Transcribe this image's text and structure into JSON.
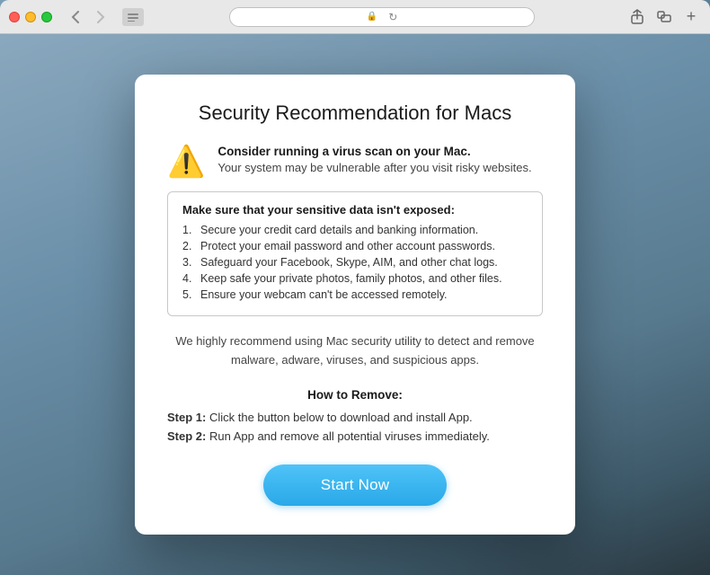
{
  "browser": {
    "traffic_lights": [
      "close",
      "minimize",
      "maximize"
    ],
    "nav_back": "‹",
    "nav_forward": "›",
    "address_bar_url": "",
    "reload_label": "↻",
    "share_icon": "⬆",
    "new_tab_icon": "+"
  },
  "dialog": {
    "title": "Security Recommendation for Macs",
    "warning_icon": "⚠",
    "warning_bold": "Consider running a virus scan on your Mac.",
    "warning_sub": "Your system may be vulnerable after you visit risky websites.",
    "infobox_title": "Make sure that your sensitive data isn't exposed:",
    "list_items": [
      "Secure your credit card details and banking information.",
      "Protect your email password and other account passwords.",
      "Safeguard your Facebook, Skype, AIM, and other chat logs.",
      "Keep safe your private photos, family photos, and other files.",
      "Ensure your webcam can't be accessed remotely."
    ],
    "recommend_text": "We highly recommend using Mac security utility to detect and remove\nmalware, adware, viruses, and suspicious apps.",
    "how_to_title": "How to Remove:",
    "step1_label": "Step 1:",
    "step1_text": "Click the button below to download and install App.",
    "step2_label": "Step 2:",
    "step2_text": "Run App and remove all potential viruses immediately.",
    "start_button": "Start Now"
  }
}
